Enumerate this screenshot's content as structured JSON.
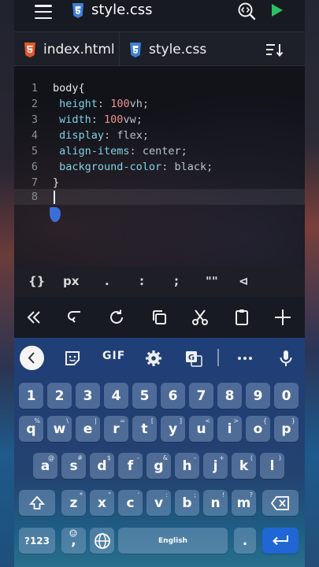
{
  "header": {
    "file_title": "style.css"
  },
  "tabs": [
    {
      "label": "index.html",
      "type": "html-file-icon"
    },
    {
      "label": "style.css",
      "type": "css-file-icon"
    }
  ],
  "editor": {
    "lines": [
      {
        "number": "1",
        "text": "body{"
      },
      {
        "number": "2",
        "prop": "height",
        "num": "100",
        "unit": "vh"
      },
      {
        "number": "3",
        "prop": "width",
        "num": "100",
        "unit": "vw"
      },
      {
        "number": "4",
        "prop": "display",
        "value": "flex"
      },
      {
        "number": "5",
        "prop": "align-items",
        "value": "center"
      },
      {
        "number": "6",
        "prop": "background-color",
        "value": "black"
      },
      {
        "number": "7",
        "text": "}"
      },
      {
        "number": "8",
        "text": ""
      }
    ],
    "active_line": "8"
  },
  "symbols": [
    "{}",
    "px",
    ".",
    ":",
    ";",
    "\"\"",
    "⊲"
  ],
  "keyboard": {
    "gif_label": "GIF",
    "row_numbers": [
      "1",
      "2",
      "3",
      "4",
      "5",
      "6",
      "7",
      "8",
      "9",
      "0"
    ],
    "row_q": [
      {
        "k": "q",
        "h": "%"
      },
      {
        "k": "w",
        "h": "\\"
      },
      {
        "k": "e",
        "h": "|"
      },
      {
        "k": "r",
        "h": "="
      },
      {
        "k": "t",
        "h": "["
      },
      {
        "k": "y",
        "h": "]"
      },
      {
        "k": "u",
        "h": "<"
      },
      {
        "k": "i",
        "h": ">"
      },
      {
        "k": "o",
        "h": "{"
      },
      {
        "k": "p",
        "h": "}"
      }
    ],
    "row_a": [
      {
        "k": "a",
        "h": "@"
      },
      {
        "k": "s",
        "h": "#"
      },
      {
        "k": "d",
        "h": "$"
      },
      {
        "k": "f",
        "h": "-"
      },
      {
        "k": "g",
        "h": "&"
      },
      {
        "k": "h",
        "h": "-"
      },
      {
        "k": "j",
        "h": "+"
      },
      {
        "k": "k",
        "h": "("
      },
      {
        "k": "l",
        "h": ")"
      }
    ],
    "row_z": [
      {
        "k": "z",
        "h": "*"
      },
      {
        "k": "x",
        "h": "\""
      },
      {
        "k": "c",
        "h": "'"
      },
      {
        "k": "v",
        "h": ":"
      },
      {
        "k": "b",
        "h": ";"
      },
      {
        "k": "n",
        "h": "!"
      },
      {
        "k": "m",
        "h": "?"
      }
    ],
    "symbols_key": "?123",
    "comma": ",",
    "space_label": "English",
    "period": "."
  },
  "colors": {
    "accent": "#2066d4",
    "run": "#2fbf62",
    "html_icon": "#e4572e",
    "css_icon": "#3e7fd6"
  }
}
